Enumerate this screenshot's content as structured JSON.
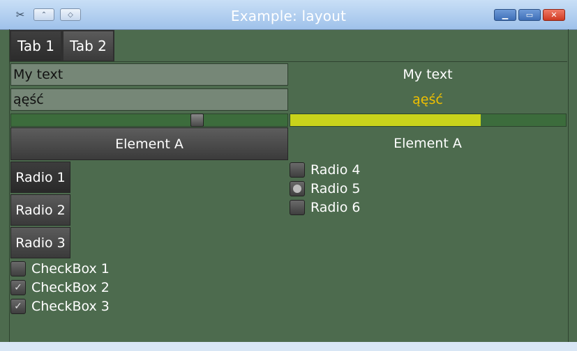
{
  "window": {
    "title": "Example: layout",
    "controls": {
      "minimize_icon": "minimize-icon",
      "maximize_icon": "maximize-icon",
      "close_icon": "close-icon"
    }
  },
  "tabs": [
    {
      "label": "Tab 1",
      "active": true
    },
    {
      "label": "Tab 2",
      "active": false
    }
  ],
  "inputs": {
    "text1": {
      "value": "My text"
    },
    "text2": {
      "value": "ąęść"
    }
  },
  "mirror": {
    "text1": "My text",
    "text2": "ąęść"
  },
  "slider": {
    "value": 0.68
  },
  "progress": {
    "value": 0.69
  },
  "element_a": {
    "button_label": "Element A",
    "label": "Element A"
  },
  "left_radios": [
    {
      "label": "Radio 1",
      "selected": true
    },
    {
      "label": "Radio 2",
      "selected": false
    },
    {
      "label": "Radio 3",
      "selected": false
    }
  ],
  "right_radios": [
    {
      "label": "Radio 4",
      "selected": false
    },
    {
      "label": "Radio 5",
      "selected": true
    },
    {
      "label": "Radio 6",
      "selected": false
    }
  ],
  "checkboxes": [
    {
      "label": "CheckBox 1",
      "checked": false
    },
    {
      "label": "CheckBox 2",
      "checked": true
    },
    {
      "label": "CheckBox 3",
      "checked": true
    }
  ],
  "colors": {
    "background": "#4d6b4e",
    "accent_text": "#f0c000",
    "progress": "#c9d31b"
  }
}
